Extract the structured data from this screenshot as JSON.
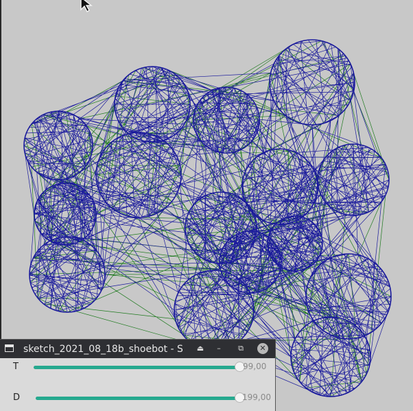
{
  "window": {
    "title": "sketch_2021_08_18b_shoebot - S",
    "buttons": {
      "shade": "⏏",
      "minimize": "–",
      "restore": "⧉",
      "close": "✕"
    }
  },
  "sliders": [
    {
      "label": "T",
      "value": 99,
      "max": 99,
      "display": "99,00"
    },
    {
      "label": "D",
      "value": 199,
      "max": 199,
      "display": "199,00"
    }
  ],
  "colors": {
    "background": "#c8c8c8",
    "line_blue": "#1a1a9c",
    "line_green": "#1e7a1e",
    "accent": "#26a98f",
    "titlebar": "#2e2f33"
  },
  "icons": {
    "cursor": "mouse-pointer-icon",
    "app": "window-app-icon"
  }
}
